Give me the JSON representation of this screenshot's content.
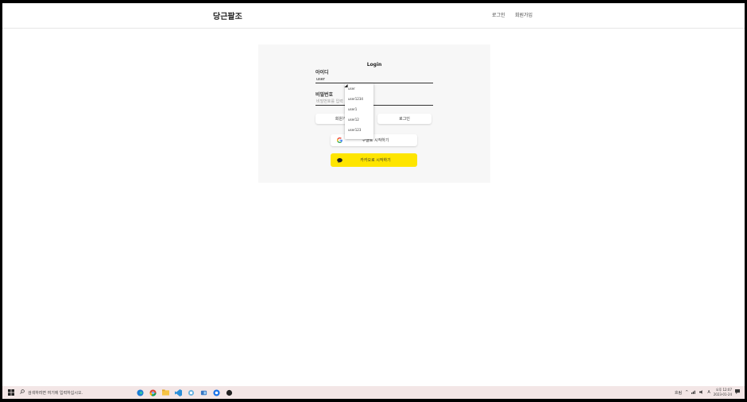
{
  "header": {
    "logo": "당근팔조",
    "nav_login": "로그인",
    "nav_signup": "회원가입"
  },
  "login": {
    "title": "Login",
    "id_label": "아이디",
    "id_value": "user",
    "pw_label": "비밀번호",
    "pw_placeholder": "비밀번호를 입력",
    "signup_button": "회원가입",
    "login_button": "로그인",
    "google_button": "구글로 시작하기",
    "kakao_button": "카카오로 시작하기"
  },
  "autocomplete": {
    "items": [
      "user",
      "user1234",
      "user1",
      "user12",
      "user123"
    ]
  },
  "taskbar": {
    "search_placeholder": "검색하려면 여기에 입력하십시오.",
    "time": "오후 12:07",
    "date": "2023-01-24",
    "weather": "흐림",
    "lang": "A"
  },
  "colors": {
    "kakao": "#fee500",
    "panel_bg": "#f7f7f7",
    "taskbar_bg": "#f3e6e6"
  }
}
